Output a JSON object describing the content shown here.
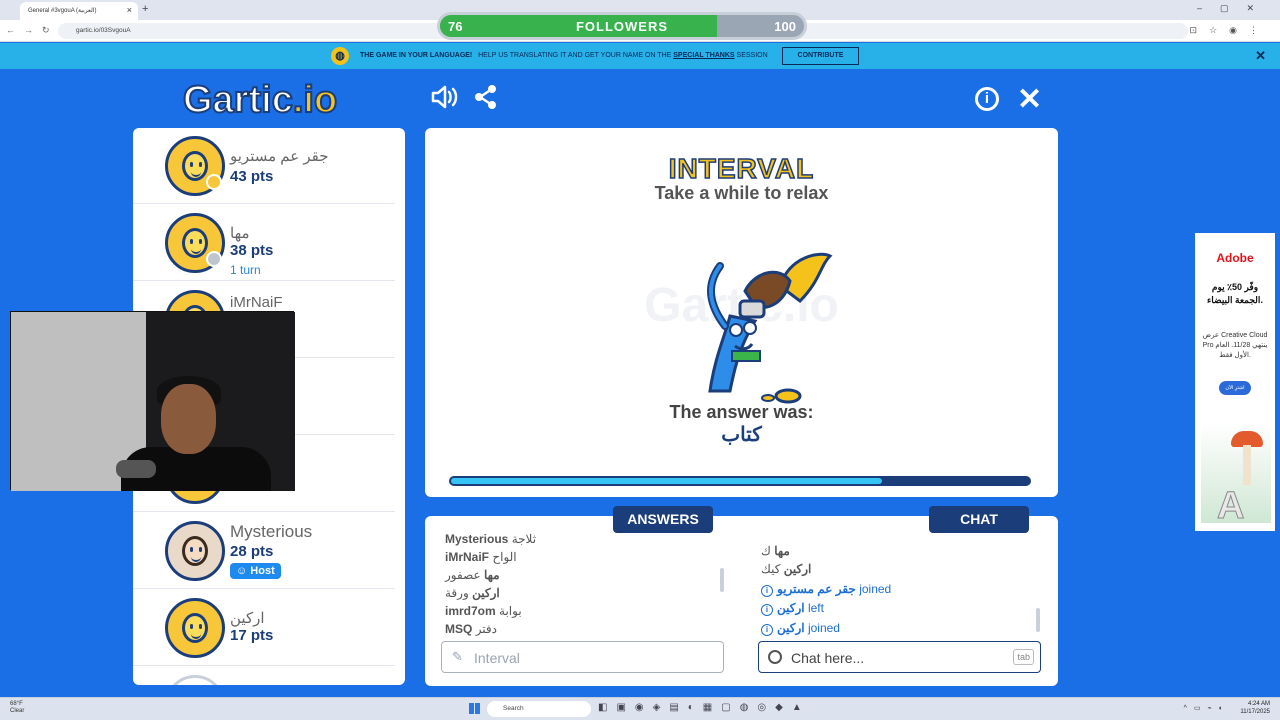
{
  "browser": {
    "tab_title": "General #3vgouA (العربية)",
    "url": "gartic.io/03SvgouA",
    "nav_glyphs": "←→↻",
    "ext_glyphs": "⊡☆◉⋮",
    "win_glyphs": "–▢✕"
  },
  "followers": {
    "current": "76",
    "label": "FOLLOWERS",
    "goal": "100",
    "progress": 0.76
  },
  "banner": {
    "bold_text": "THE GAME IN YOUR LANGUAGE!",
    "text": "HELP US TRANSLATING IT AND GET YOUR NAME ON THE",
    "special": "SPECIAL THANKS",
    "session": "SESSION",
    "contribute_label": "CONTRIBUTE"
  },
  "header": {
    "logo": "Gartic",
    "logo_suffix": ".io"
  },
  "players": [
    {
      "name": "جقر عم مستريو",
      "points": "43 pts",
      "badge": "yellow"
    },
    {
      "name": "مها",
      "points": "38 pts",
      "turn": "1 turn",
      "badge": "gray"
    },
    {
      "name": "iMrNaiF",
      "points": ""
    },
    {
      "name": "",
      "points": ""
    },
    {
      "name": "",
      "points": ""
    },
    {
      "name": "Mysterious",
      "points": "28 pts",
      "host": "Host",
      "photo": true
    },
    {
      "name": "اركين",
      "points": "17 pts"
    }
  ],
  "game": {
    "status_title": "INTERVAL",
    "status_subtitle": "Take a while to relax",
    "watermark": "Gartic.io",
    "answer_label": "The answer was:",
    "answer": "كتاب",
    "timer_progress": 0.74
  },
  "answers": {
    "tab_label": "ANSWERS",
    "messages": [
      {
        "user": "Mysterious",
        "text": "ثلاجة"
      },
      {
        "user": "iMrNaiF",
        "text": "الواح"
      },
      {
        "user": "مها",
        "text": "عصفور"
      },
      {
        "user": "اركين",
        "text": "ورقة"
      },
      {
        "user": "imrd7om",
        "text": "بوابة"
      },
      {
        "user": "MSQ",
        "text": "دفتر"
      }
    ],
    "input_placeholder": "Interval"
  },
  "chat": {
    "tab_label": "CHAT",
    "messages": [
      {
        "user": "مها",
        "text": "ك"
      },
      {
        "user": "اركين",
        "text": "كيك"
      }
    ],
    "events": [
      {
        "user": "جقر عم مستريو",
        "action": "joined"
      },
      {
        "user": "اركين",
        "action": "left"
      },
      {
        "user": "اركين",
        "action": "joined"
      }
    ],
    "input_placeholder": "Chat here...",
    "tab_hint": "tab"
  },
  "ad": {
    "brand": "Adobe",
    "headline": "وفّر 50٪ يوم الجمعة البيضاء.",
    "body": "عرض Creative Cloud Pro ينتهي 11/28. العام الأول فقط.",
    "cta": "اشترِ الآن"
  },
  "taskbar": {
    "temp": "68°F",
    "weather": "Clear",
    "search": "Search",
    "time": "4:24 AM",
    "date": "11/17/2025"
  },
  "colors": {
    "navy": "#1b3d7a",
    "page_blue": "#1a6ee6",
    "yellow": "#f6c21a",
    "cyan": "#36c3f5",
    "green": "#37b24d"
  }
}
